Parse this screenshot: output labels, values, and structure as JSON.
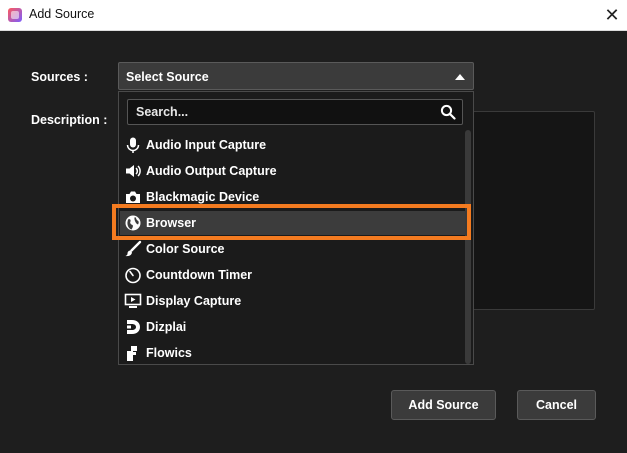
{
  "window": {
    "title": "Add Source",
    "close_label": "✕"
  },
  "form": {
    "sources_label": "Sources :",
    "description_label": "Description :",
    "selected_source": "Select Source"
  },
  "dropdown": {
    "search_placeholder": "Search...",
    "items": [
      {
        "label": "Audio Input Capture",
        "icon": "microphone-icon"
      },
      {
        "label": "Audio Output Capture",
        "icon": "speaker-icon"
      },
      {
        "label": "Blackmagic Device",
        "icon": "camera-icon"
      },
      {
        "label": "Browser",
        "icon": "globe-icon"
      },
      {
        "label": "Color Source",
        "icon": "brush-icon"
      },
      {
        "label": "Countdown Timer",
        "icon": "timer-icon"
      },
      {
        "label": "Display Capture",
        "icon": "monitor-icon"
      },
      {
        "label": "Dizplai",
        "icon": "dizplai-icon"
      },
      {
        "label": "Flowics",
        "icon": "flowics-icon"
      }
    ],
    "highlighted_item": "Browser"
  },
  "buttons": {
    "add_source": "Add Source",
    "cancel": "Cancel"
  },
  "colors": {
    "background": "#1e1e1e",
    "highlight": "#f47b20",
    "button": "#3b3b3b"
  }
}
